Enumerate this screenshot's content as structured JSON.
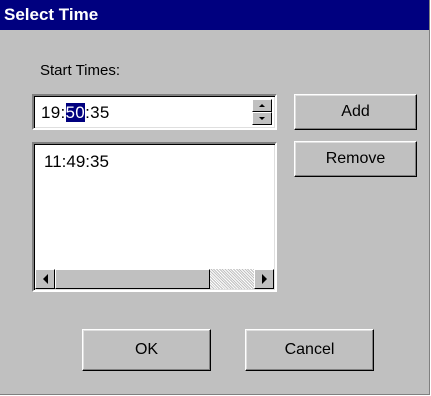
{
  "window": {
    "title": "Select Time"
  },
  "start_times_label": "Start Times:",
  "time_input": {
    "hour": "19",
    "sep1": ":",
    "minute": "50",
    "sep2": ":",
    "second": "35"
  },
  "list": {
    "items": [
      "11:49:35"
    ]
  },
  "buttons": {
    "add": "Add",
    "remove": "Remove",
    "ok": "OK",
    "cancel": "Cancel"
  },
  "colors": {
    "titlebar": "#00007f",
    "face": "#c0c0c0",
    "selection": "#00007f"
  }
}
